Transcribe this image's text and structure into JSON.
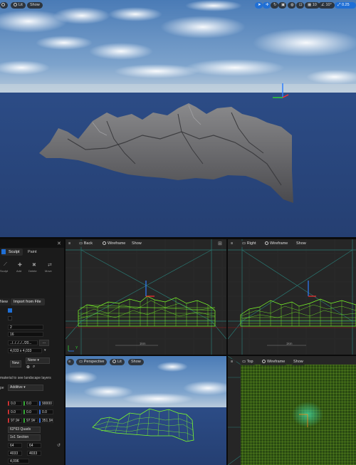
{
  "main_viewport": {
    "toolbar_left": [
      "view-mode",
      "Lit",
      "Show"
    ],
    "toolbar_right_values": {
      "grid": "10",
      "angle": "10°",
      "scale": "0.25",
      "camera_speed": "4"
    }
  },
  "landscape_panel": {
    "tabs": [
      "Sculpt",
      "Paint"
    ],
    "tools": [
      "Sculpt",
      "Add",
      "Delete",
      "Move"
    ],
    "import_tabs": [
      "New",
      "Import from File"
    ],
    "fields": {
      "section_size": "2",
      "sections_per_component": "16",
      "heightmap_path": "../../../../../20...",
      "resolution": "4,033 x 4,033",
      "layer_info_label": "None",
      "material_hint": "material to see landscape layers",
      "blend_label": "Additive",
      "location": [
        "0.0",
        "0.0",
        "90000"
      ],
      "rotation": [
        "0.0",
        "0.0",
        "0.0"
      ],
      "scale": [
        "97.9#",
        "97.9#",
        "351.9#"
      ],
      "quads_label": "63*63 Quads",
      "section_label": "1x1 Section",
      "components": [
        "64",
        "64"
      ],
      "overall": [
        "4033",
        "4033"
      ],
      "total": "4,096"
    },
    "none_button": "None",
    "new_button": "New"
  },
  "back_viewport": {
    "title": "Back",
    "mode": "Wireframe",
    "show": "Show",
    "scale_label": "1km",
    "axis_y": "Y"
  },
  "right_viewport": {
    "title": "Right",
    "mode": "Wireframe",
    "show": "Show",
    "scale_label": "1km"
  },
  "perspective_viewport": {
    "title": "Perspective",
    "mode": "Lit",
    "show": "Show"
  },
  "top_viewport": {
    "title": "Top",
    "mode": "Wireframe",
    "show": "Show"
  },
  "colors": {
    "mesh_green": "#7dff2a",
    "grid_cyan": "#2a7a74",
    "sky_top": "#4f7fb8",
    "ocean": "#2d4a7d",
    "rock": "#6a6a6d"
  }
}
